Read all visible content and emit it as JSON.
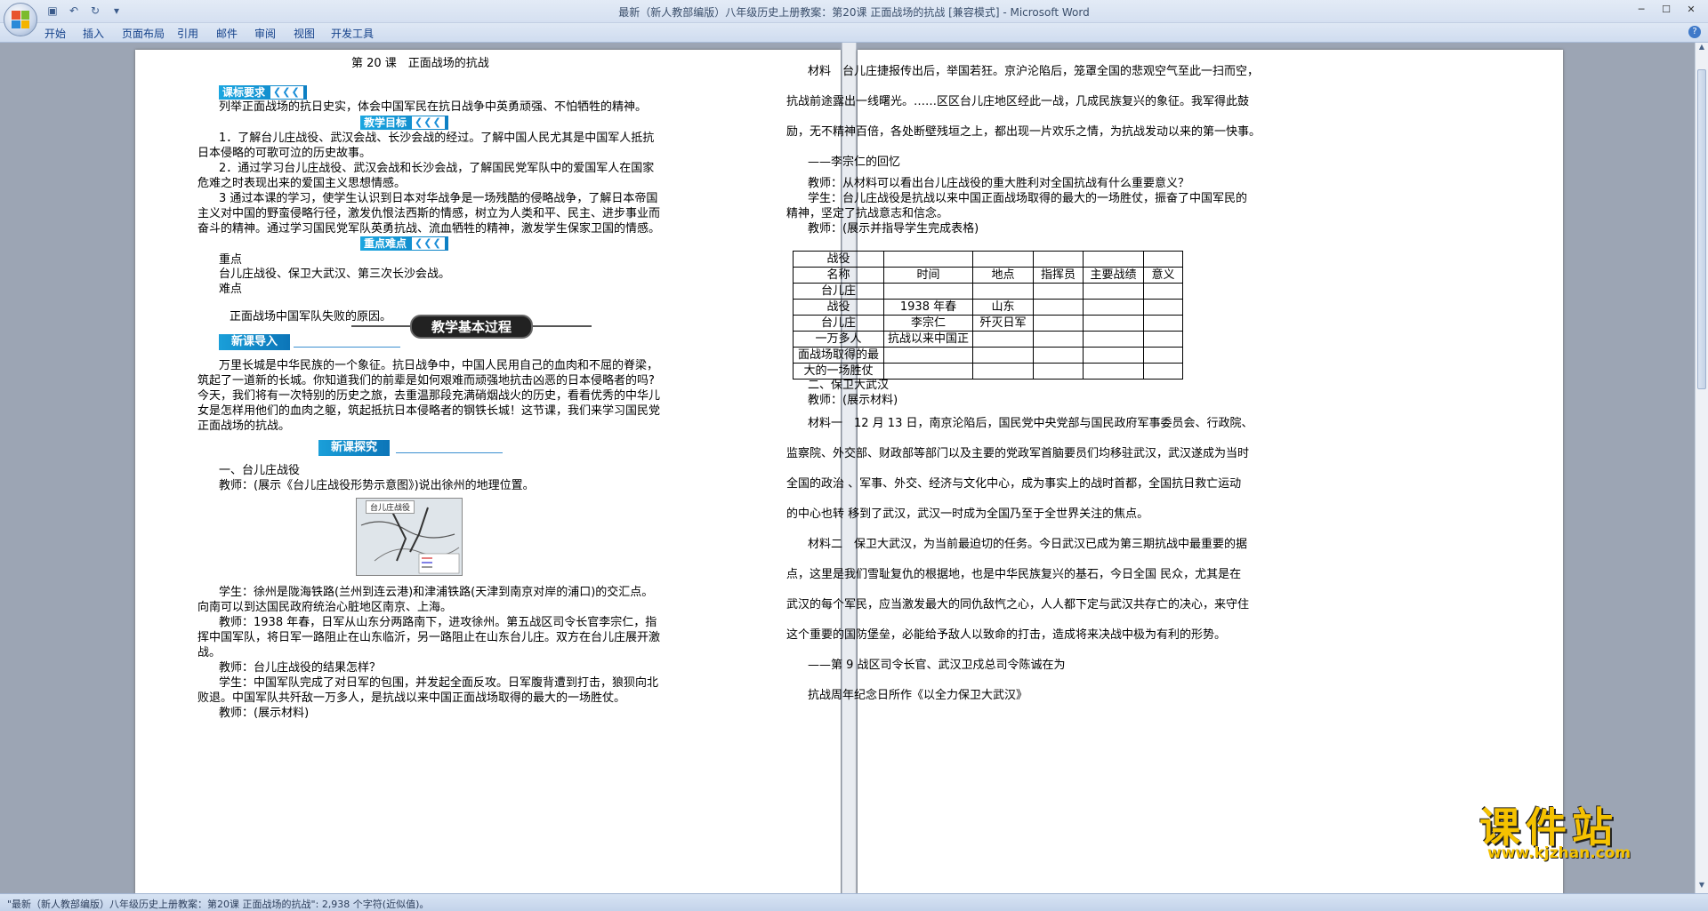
{
  "window": {
    "title": "最新（新人教部编版）八年级历史上册教案：第20课 正面战场的抗战 [兼容模式] - Microsoft Word"
  },
  "ribbon": {
    "tabs": [
      "开始",
      "插入",
      "页面布局",
      "引用",
      "邮件",
      "审阅",
      "视图",
      "开发工具"
    ]
  },
  "status": {
    "text": "\"最新（新人教部编版）八年级历史上册教案：第20课 正面战场的抗战\": 2,938 个字符(近似值)。"
  },
  "page1": {
    "title": "第 20 课　正面战场的抗战",
    "banner_req": "课标要求",
    "req_text": "列举正面战场的抗日史实，体会中国军民在抗日战争中英勇顽强、不怕牺牲的精神。",
    "banner_goal": "教学目标",
    "goal1a": "1．了解台儿庄战役、武汉会战、长沙会战的经过。了解中国人民尤其是中国军人抵抗",
    "goal1b": "日本侵略的可歌可泣的历史故事。",
    "goal2a": "2．通过学习台儿庄战役、武汉会战和长沙会战，了解国民党军队中的爱国军人在国家",
    "goal2b": "危难之时表现出来的爱国主义思想情感。",
    "goal3a": "3 通过本课的学习，使学生认识到日本对华战争是一场残酷的侵略战争，了解日本帝国",
    "goal3b": "主义对中国的野蛮侵略行径，激发仇恨法西斯的情感，树立为人类和平、民主、进步事业而",
    "goal3c": "奋斗的精神。通过学习国民党军队英勇抗战、流血牺牲的精神，激发学生保家卫国的情感。",
    "banner_key": "重点难点",
    "key_label": "重点",
    "key_text": "台儿庄战役、保卫大武汉、第三次长沙会战。",
    "diff_label": "难点",
    "diff_text": "正面战场中国军队失败的原因。",
    "process_label": "教学基本过程",
    "banner_intro": "新课导入",
    "intro1": "万里长城是中华民族的一个象征。抗日战争中，中国人民用自己的血肉和不屈的脊梁，",
    "intro2": "筑起了一道新的长城。你知道我们的前辈是如何艰难而顽强地抗击凶恶的日本侵略者的吗?",
    "intro3": "今天，我们将有一次特别的历史之旅，去重温那段充满硝烟战火的历史，看看优秀的中华儿",
    "intro4": "女是怎样用他们的血肉之躯，筑起抵抗日本侵略者的钢铁长城！这节课，我们来学习国民党",
    "intro5": "正面战场的抗战。",
    "banner_explore": "新课探究",
    "sec1": "一、台儿庄战役",
    "teacher1": "教师：(展示《台儿庄战役形势示意图》)说出徐州的地理位置。",
    "map_title": "台儿庄战役",
    "stu1a": "学生：徐州是陇海铁路(兰州到连云港)和津浦铁路(天津到南京对岸的浦口)的交汇点。",
    "stu1b": "向南可以到达国民政府统治心脏地区南京、上海。",
    "teacher2a": "教师：1938 年春，日军从山东分两路南下，进攻徐州。第五战区司令长官李宗仁，指",
    "teacher2b": "挥中国军队，将日军一路阻止在山东临沂，另一路阻止在山东台儿庄。双方在台儿庄展开激",
    "teacher2c": "战。",
    "teacher3": "教师：台儿庄战役的结果怎样？",
    "stu2a": "学生：中国军队完成了对日军的包围，并发起全面反攻。日军腹背遭到打击，狼狈向北",
    "stu2b": "败退。中国军队共歼敌一万多人，是抗战以来中国正面战场取得的最大的一场胜仗。",
    "teacher4": "教师：(展示材料)"
  },
  "page2": {
    "m1a": "材料　台儿庄捷报传出后，举国若狂。京沪沦陷后，笼罩全国的悲观空气至此一扫而空，",
    "m1b": "抗战前途露出一线曙光。……区区台儿庄地区经此一战，几成民族复兴的象征。我军得此鼓",
    "m1c": "励，无不精神百倍，各处断壁残垣之上，都出现一片欢乐之情，为抗战发动以来的第一快事。",
    "m1src": "——李宗仁的回忆",
    "q1": "教师：从材料可以看出台儿庄战役的重大胜利对全国抗战有什么重要意义？",
    "a1a": "学生：台儿庄战役是抗战以来中国正面战场取得的最大的一场胜仗，振奋了中国军民的",
    "a1b": "精神，坚定了抗战意志和信念。",
    "t2": "教师：(展示并指导学生完成表格)",
    "table": [
      [
        "战役",
        "",
        "",
        "",
        "",
        ""
      ],
      [
        "名称",
        "时间",
        "地点",
        "指挥员",
        "主要战绩",
        "意义"
      ],
      [
        "台儿庄",
        "",
        "",
        "",
        "",
        ""
      ],
      [
        "战役",
        "1938 年春",
        "山东",
        "",
        "",
        ""
      ],
      [
        "台儿庄",
        "李宗仁",
        "歼灭日军",
        "",
        "",
        ""
      ],
      [
        "一万多人",
        "抗战以来中国正",
        "",
        "",
        "",
        ""
      ],
      [
        "面战场取得的最",
        "",
        "",
        "",
        "",
        ""
      ],
      [
        "大的一场胜仗",
        "",
        "",
        "",
        "",
        ""
      ]
    ],
    "sec2": "二、保卫大武汉",
    "t3": "教师：(展示材料)",
    "m2a": "材料一　12 月 13 日，南京沦陷后，国民党中央党部与国民政府军事委员会、行政院、",
    "m2b": "监察院、外交部、财政部等部门以及主要的党政军首脑要员们均移驻武汉，武汉遂成为当时",
    "m2c": "全国的政治 、军事、外交、经济与文化中心，成为事实上的战时首都，全国抗日救亡运动",
    "m2d": "的中心也转 移到了武汉，武汉一时成为全国乃至于全世界关注的焦点。",
    "m3a": "材料二　保卫大武汉，为当前最迫切的任务。今日武汉已成为第三期抗战中最重要的据",
    "m3b": "点，这里是我们雪耻复仇的根据地，也是中华民族复兴的基石，今日全国 民众，尤其是在",
    "m3c": "武汉的每个军民，应当激发最大的同仇敌忾之心，人人都下定与武汉共存亡的决心，来守住",
    "m3d": "这个重要的国防堡垒，必能给予敌人以致命的打击，造成将来决战中极为有利的形势。",
    "m3src": "——第 9 战区司令长官、武汉卫戍总司令陈诚在为",
    "m3src2": "抗战周年纪念日所作《以全力保卫大武汉》"
  },
  "watermark": {
    "logo": "课件站",
    "url": "www.kjzhan.com"
  },
  "colors": {
    "banner": "#1aa6e0",
    "title_bar": "#dfe8f5",
    "status_bar": "#c3d3ea",
    "logo": "#f5c200"
  }
}
